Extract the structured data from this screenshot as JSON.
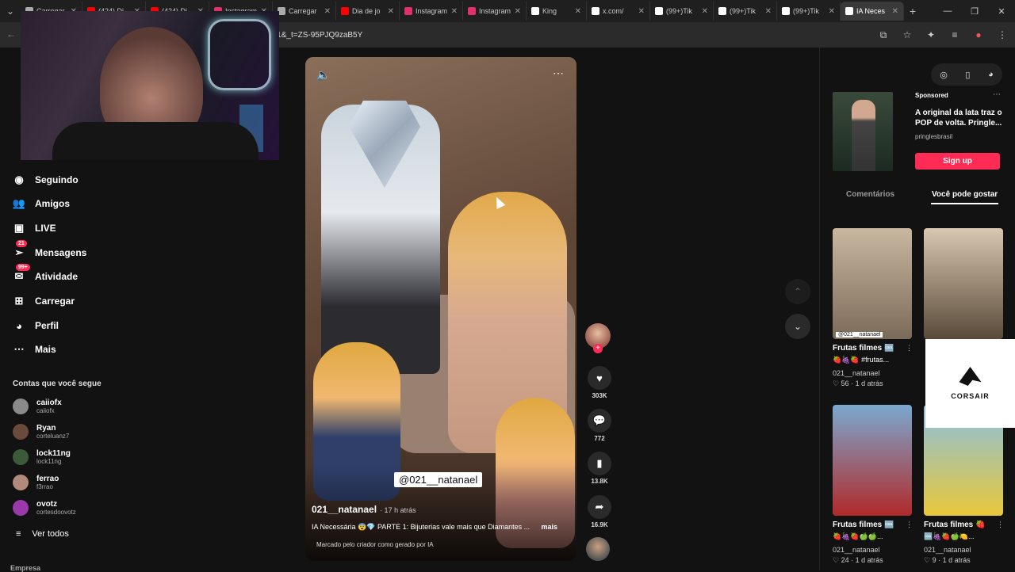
{
  "browser": {
    "tabs": [
      {
        "label": "Carregar",
        "color": "#aaaaaa"
      },
      {
        "label": "(424) Di",
        "color": "#ff0000"
      },
      {
        "label": "(424) Di",
        "color": "#ff0000"
      },
      {
        "label": "Instagram",
        "color": "#e1306c"
      },
      {
        "label": "Carregar",
        "color": "#aaaaaa"
      },
      {
        "label": "Dia de jo",
        "color": "#ff0000"
      },
      {
        "label": "Instagram",
        "color": "#e1306c"
      },
      {
        "label": "Instagram",
        "color": "#e1306c"
      },
      {
        "label": "King",
        "color": "#ffffff"
      },
      {
        "label": "x.com/",
        "color": "#ffffff"
      },
      {
        "label": "(99+)Tik",
        "color": "#ffffff"
      },
      {
        "label": "(99+)Tik",
        "color": "#ffffff"
      },
      {
        "label": "(99+)Tik",
        "color": "#ffffff"
      },
      {
        "label": "IA Neces",
        "color": "#ffffff",
        "active": true
      }
    ],
    "url": "r=1&_t=ZS-95PJQ9zaB5Y"
  },
  "sidebar": {
    "nav": [
      {
        "label": "Seguindo",
        "icon": "avatar-icon"
      },
      {
        "label": "Amigos",
        "icon": "friends-icon"
      },
      {
        "label": "LIVE",
        "icon": "live-icon"
      },
      {
        "label": "Mensagens",
        "icon": "messages-icon",
        "badge": "21"
      },
      {
        "label": "Atividade",
        "icon": "activity-icon",
        "badge": "99+"
      },
      {
        "label": "Carregar",
        "icon": "upload-icon"
      },
      {
        "label": "Perfil",
        "icon": "profile-icon"
      },
      {
        "label": "Mais",
        "icon": "more-icon"
      }
    ],
    "following_title": "Contas que você segue",
    "accounts": [
      {
        "name": "caiiofx",
        "handle": "caiiofx",
        "color": "#8a8a8a"
      },
      {
        "name": "Ryan",
        "handle": "corteluanz7",
        "color": "#6a4a3a"
      },
      {
        "name": "lock11ng",
        "handle": "lock11ng",
        "color": "#3a5a3a"
      },
      {
        "name": "ferrao",
        "handle": "f3rrao",
        "color": "#b08a7a"
      },
      {
        "name": "ovotz",
        "handle": "cortesdoovotz",
        "color": "#9a3aaa"
      }
    ],
    "see_all": "Ver todos",
    "company": "Empresa"
  },
  "video": {
    "watermark": "@021__natanael",
    "author": "021__natanael",
    "posted": "· 17 h atrás",
    "caption": "IA Necessária 😨💎 PARTE 1: Bijuterias vale mais que Diamantes ...",
    "more": "mais",
    "ai_label": "Marcado pelo criador como gerado por IA"
  },
  "actions": {
    "likes": "303K",
    "comments": "772",
    "saves": "13.8K",
    "shares": "16.9K"
  },
  "ad": {
    "sponsored": "Sponsored",
    "title": "A original da lata traz o POP de volta. Pringle...",
    "brand": "pringlesbrasil",
    "cta": "Sign up"
  },
  "right_tabs": {
    "comments": "Comentários",
    "you_may_like": "Você pode gostar"
  },
  "cards": [
    {
      "title": "Frutas filmes 🆒",
      "sub": "🍓🍇🍓 #frutas...",
      "user": "021__natanael",
      "meta": "♡ 56 · 1 d atrás",
      "tag": "@021__natanael",
      "bg1": "#c9b8a0",
      "bg2": "#7a6a58"
    },
    {
      "title": "",
      "sub": "",
      "user": "",
      "meta": "",
      "tag": "",
      "bg1": "#d8c8b0",
      "bg2": "#5a4a3a"
    },
    {
      "title": "Frutas filmes 🆒",
      "sub": "🍓🍇🍓🍏🍏...",
      "user": "021__natanael",
      "meta": "♡ 24 · 1 d atrás",
      "tag": "",
      "bg1": "#7aa8d0",
      "bg2": "#b02a2a"
    },
    {
      "title": "Frutas filmes 🍓",
      "sub": "🆒🍇🍓🍏🍋...",
      "user": "021__natanael",
      "meta": "♡ 9 · 1 d atrás",
      "tag": "",
      "bg1": "#8ac0e0",
      "bg2": "#e8c83a"
    }
  ],
  "overlay_brand": "CORSAIR"
}
